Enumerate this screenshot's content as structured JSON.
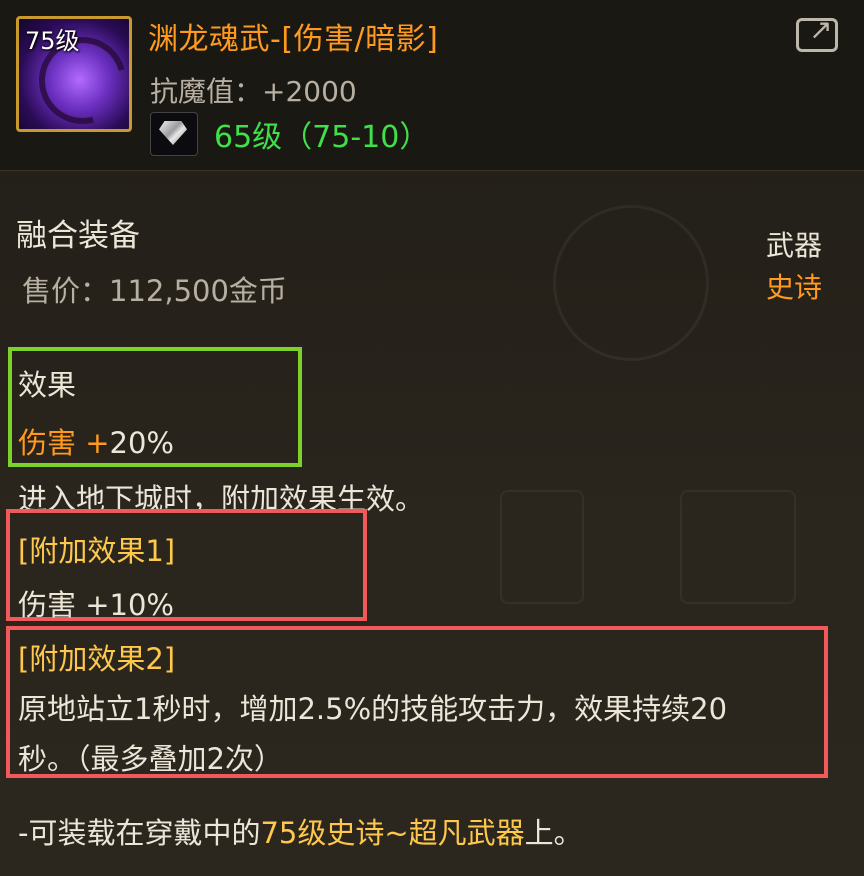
{
  "item": {
    "level_tag": "75级",
    "title": "渊龙魂武-[伤害/暗影]",
    "resist": "抗魔值：+2000",
    "gem_level": "65级（75-10）",
    "type": "融合装备",
    "price": "售价：112,500金币",
    "slot": "武器",
    "rarity": "史诗"
  },
  "effect": {
    "title": "效果",
    "label": "伤害 +",
    "value": "20%",
    "condition": "进入地下城时，附加效果生效。"
  },
  "extra1": {
    "title": "[附加效果1]",
    "value": "伤害 +10%"
  },
  "extra2": {
    "title": "[附加效果2]",
    "line1": "原地站立1秒时，增加2.5%的技能攻击力，效果持续20",
    "line2": "秒。（最多叠加2次）"
  },
  "equip_note": {
    "prefix": "-可装载在穿戴中的",
    "highlight": "75级史诗~超凡武器",
    "suffix": "上。"
  },
  "icons": {
    "item": "weapon-item-icon",
    "gem": "gem-icon",
    "share": "share-icon"
  },
  "colors": {
    "orange": "#ff9a1f",
    "gold": "#ffc84a",
    "green_text": "#3fe04a",
    "green_box": "#7cd12a",
    "red_box": "#f05a5a"
  }
}
